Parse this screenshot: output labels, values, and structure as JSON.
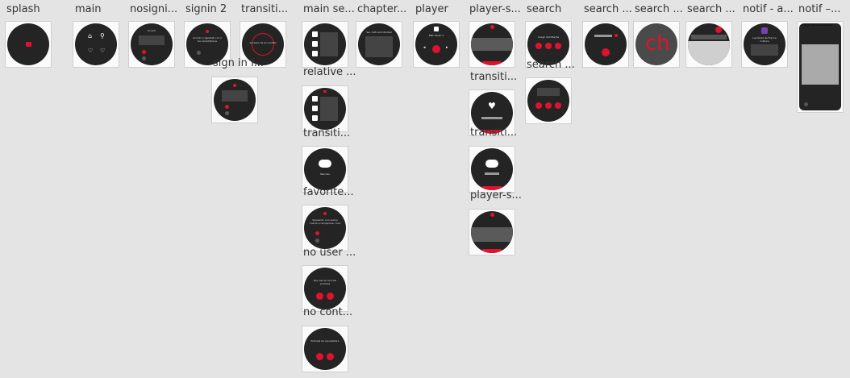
{
  "labels": {
    "splash": "splash",
    "main": "main",
    "nosignin": "nosigni...",
    "signin2": "signin 2",
    "transition1": "transiti...",
    "mainse": "main se...",
    "chapter": "chapter...",
    "player": "player",
    "player_s": "player-s...",
    "search": "search",
    "search2": "search ...",
    "search3": "search ...",
    "search4": "search ...",
    "notif_a": "notif - a...",
    "notif2": "notif –...",
    "signin_f": "sign in f...",
    "relative": "relative ...",
    "transiti_mid": "transiti...",
    "favorite": "favorite...",
    "no_user": "no user ...",
    "no_cont": "no cont...",
    "search_sub": "search ...",
    "transiti_p1": "transiti...",
    "transiti_p2": "transiti...",
    "player_s2": "player-s..."
  },
  "screens": {
    "nosignin_text": "Accedi",
    "signin2_text": "Accedi o registrati con il tuo smartphone",
    "transition_text": "Accesso da tuo profilo",
    "chapter_text": "Sei, tutti and divided",
    "player_text": "BBC Radio 4",
    "search_text": "Scegli l'emittente",
    "notif_title": "Les Nuits de France Culture",
    "favorite_text": "Mercato",
    "no_user_text": "Spiacenti, non siamo riusciti a recuperare i tuoi",
    "no_cont_text": "Non hai ancora dei podcast",
    "last_text": "Podcast da visualizzare"
  },
  "colors": {
    "accent": "#e0132e",
    "watch_face": "#242424",
    "background": "#e4e4e4"
  }
}
